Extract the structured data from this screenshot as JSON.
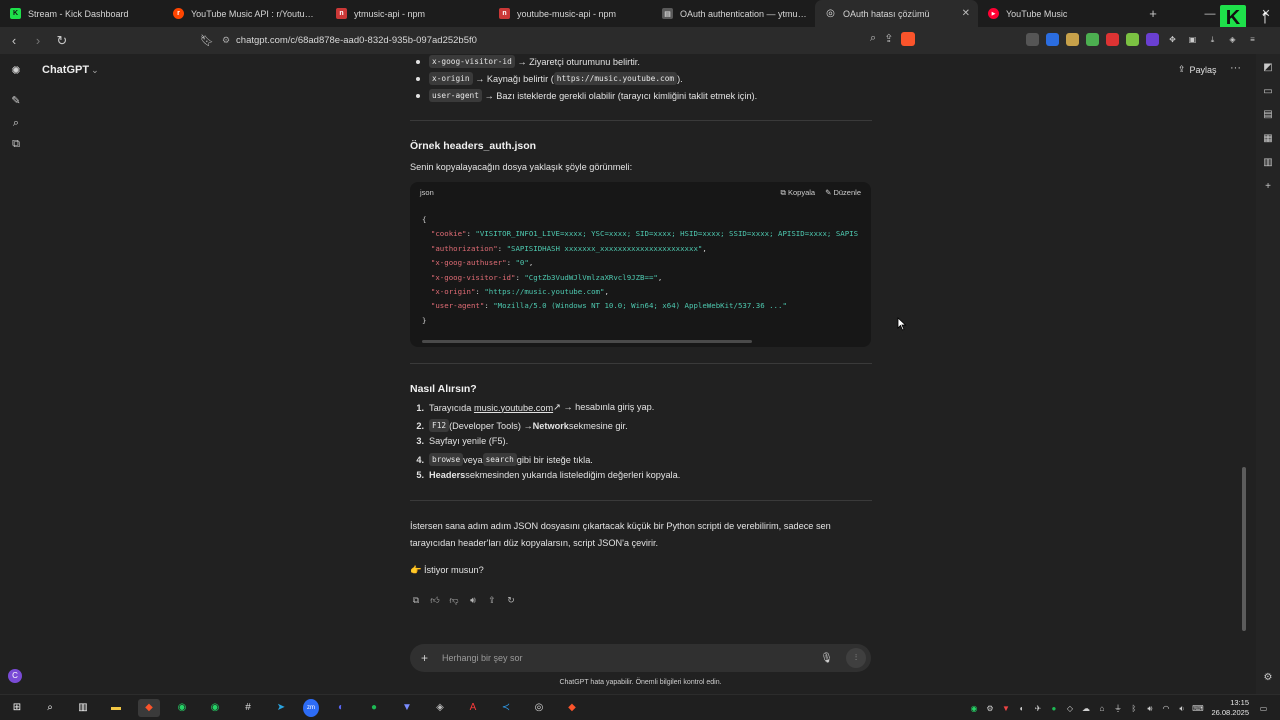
{
  "browser": {
    "tabs": [
      {
        "title": "Stream - Kick Dashboard",
        "color": "#1ee04a",
        "glyph": "K"
      },
      {
        "title": "YouTube Music API : r/YoutubeMusic",
        "color": "#ff4500",
        "glyph": "r"
      },
      {
        "title": "ytmusic-api - npm",
        "color": "#cb3837",
        "glyph": "n"
      },
      {
        "title": "youtube-music-api - npm",
        "color": "#cb3837",
        "glyph": "n"
      },
      {
        "title": "OAuth authentication — ytmusicapi",
        "color": "#5a5a5a",
        "glyph": "▤"
      },
      {
        "title": "OAuth hatası çözümü",
        "color": "#3a3a3a",
        "glyph": "◎",
        "active": true
      },
      {
        "title": "YouTube Music",
        "color": "#ff0033",
        "glyph": "▶"
      }
    ],
    "url": "chatgpt.com/c/68ad878e-aad0-832d-935b-097ad252b5f0"
  },
  "app": {
    "brand": "ChatGPT",
    "share_label": "Paylaş"
  },
  "content": {
    "bullets": [
      {
        "code": "x-goog-visitor-id",
        "text": "→ Ziyaretçi oturumunu belirtir."
      },
      {
        "code": "x-origin",
        "text_before": "→ Kaynağı belirtir (",
        "code2": "https://music.youtube.com",
        "text_after": ")."
      },
      {
        "code": "user-agent",
        "text": "→ Bazı isteklerde gerekli olabilir (tarayıcı kimliğini taklit etmek için)."
      }
    ],
    "example_heading": "Örnek headers_auth.json",
    "example_intro": "Senin kopyalayacağın dosya yaklaşık şöyle görünmeli:",
    "code_lang": "json",
    "copy_label": "Kopyala",
    "edit_label": "Düzenle",
    "code_lines": [
      {
        "key": "\"cookie\"",
        "val": "\"VISITOR_INFO1_LIVE=xxxx; YSC=xxxx; SID=xxxx; HSID=xxxx; SSID=xxxx; APISID=xxxx; SAPIS"
      },
      {
        "key": "\"authorization\"",
        "val": "\"SAPISIDHASH xxxxxxx_xxxxxxxxxxxxxxxxxxxxxx\""
      },
      {
        "key": "\"x-goog-authuser\"",
        "val": "\"0\""
      },
      {
        "key": "\"x-goog-visitor-id\"",
        "val": "\"CgtZb3VudWJlVmlzaXRvcl9JZB==\""
      },
      {
        "key": "\"x-origin\"",
        "val": "\"https://music.youtube.com\""
      },
      {
        "key": "\"user-agent\"",
        "val": "\"Mozilla/5.0 (Windows NT 10.0; Win64; x64) AppleWebKit/537.36 ...\""
      }
    ],
    "how_heading": "Nasıl Alırsın?",
    "steps": [
      {
        "num": "1.",
        "a": "Tarayıcıda ",
        "link": "music.youtube.com",
        "b": " ↗ → hesabınla giriş yap."
      },
      {
        "num": "2.",
        "code": "F12",
        "a": " (Developer Tools) → ",
        "bold": "Network",
        "b": " sekmesine gir."
      },
      {
        "num": "3.",
        "a": "Sayfayı yenile (F5)."
      },
      {
        "num": "4.",
        "code": "browse",
        "a": " veya ",
        "code2": "search",
        "b": " gibi bir isteğe tıkla."
      },
      {
        "num": "5.",
        "bold": "Headers",
        "a": " sekmesinden yukarıda listelediğim değerleri kopyala."
      }
    ],
    "closing_line1": "İstersen sana adım adım JSON dosyasını çıkartacak küçük bir Python scripti de verebilirim, sadece sen",
    "closing_line2": "tarayıcıdan header'ları düz kopyalarsın, script JSON'a çevirir.",
    "question": "👉 İstiyor musun?"
  },
  "composer": {
    "placeholder": "Herhangi bir şey sor",
    "disclaimer": "ChatGPT hata yapabilir. Önemli bilgileri kontrol edin."
  },
  "taskbar": {
    "time": "13:15",
    "date": "26.08.2025"
  }
}
